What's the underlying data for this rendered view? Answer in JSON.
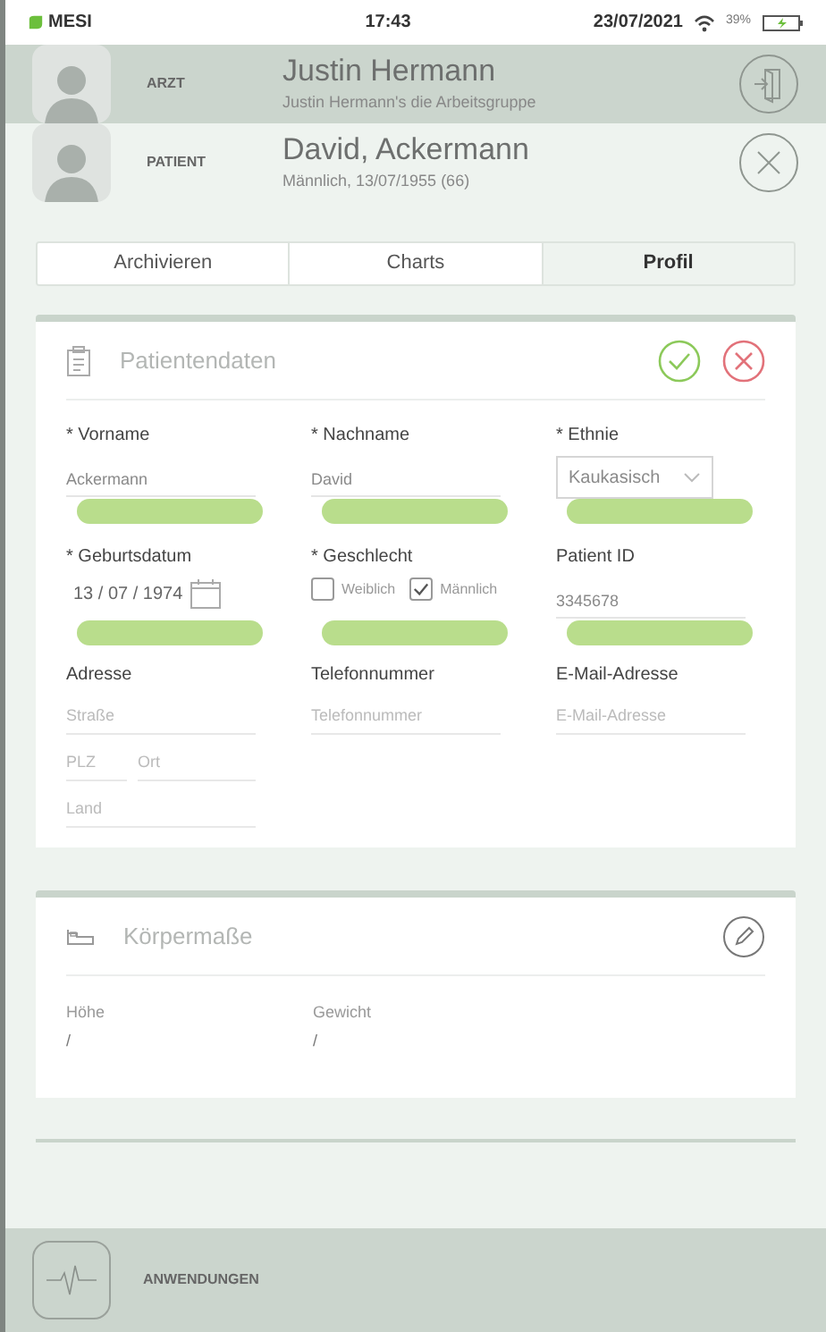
{
  "status_bar": {
    "brand": "MESI",
    "time": "17:43",
    "date": "23/07/2021",
    "battery": "39%"
  },
  "doctor": {
    "role": "ARZT",
    "name": "Justin Hermann",
    "subtitle": "Justin Hermann's die Arbeitsgruppe"
  },
  "patient": {
    "role": "PATIENT",
    "name": "David, Ackermann",
    "subtitle": "Männlich, 13/07/1955 (66)"
  },
  "tabs": [
    {
      "label": "Archivieren",
      "selected": false
    },
    {
      "label": "Charts",
      "selected": false
    },
    {
      "label": "Profil",
      "selected": true
    }
  ],
  "patient_data": {
    "title": "Patientendaten",
    "fields": [
      {
        "kind": "text",
        "label": "* Vorname",
        "value": "Ackermann"
      },
      {
        "kind": "text",
        "label": "* Nachname",
        "value": "David"
      },
      {
        "kind": "select",
        "label": "* Ethnie",
        "value": "Kaukasisch"
      },
      {
        "kind": "date",
        "label": "* Geburtsdatum",
        "value": "13 / 07 / 1974"
      },
      {
        "kind": "gender",
        "label": "* Geschlecht",
        "options": [
          {
            "label": "Weiblich",
            "checked": false
          },
          {
            "label": "Männlich",
            "checked": true
          }
        ]
      },
      {
        "kind": "text",
        "label": "Patient ID",
        "value": "3345678"
      }
    ],
    "address": {
      "label": "Adresse",
      "street": "Straße",
      "zip": "PLZ",
      "city": "Ort",
      "country": "Land"
    },
    "phone": {
      "label": "Telefonnummer",
      "placeholder": "Telefonnummer"
    },
    "email": {
      "label": "E-Mail-Adresse",
      "placeholder": "E-Mail-Adresse"
    }
  },
  "body_measures": {
    "title": "Körpermaße",
    "items": [
      {
        "label": "Höhe",
        "value": "/"
      },
      {
        "label": "Gewicht",
        "value": "/"
      }
    ]
  },
  "footer": {
    "label": "ANWENDUNGEN"
  }
}
